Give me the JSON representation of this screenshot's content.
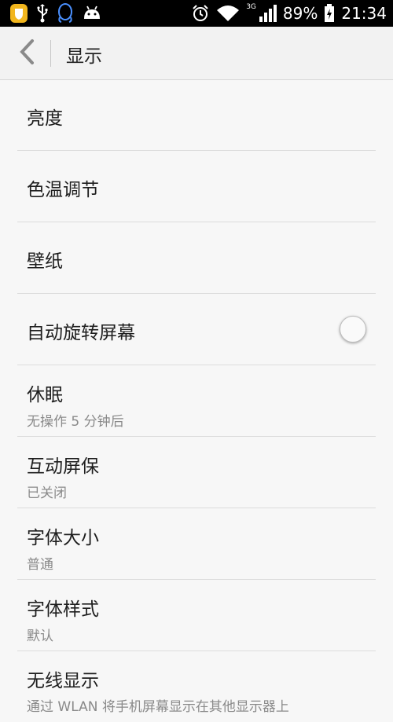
{
  "status_bar": {
    "network": "3G",
    "battery": "89%",
    "time": "21:34",
    "icons": [
      "shield-icon",
      "usb-icon",
      "qq-icon",
      "android-icon",
      "alarm-icon",
      "wifi-icon",
      "signal-icon",
      "battery-icon"
    ]
  },
  "header": {
    "title": "显示"
  },
  "settings": {
    "brightness": {
      "title": "亮度"
    },
    "color_temp": {
      "title": "色温调节"
    },
    "wallpaper": {
      "title": "壁纸"
    },
    "auto_rotate": {
      "title": "自动旋转屏幕",
      "enabled": false
    },
    "sleep": {
      "title": "休眠",
      "value": "无操作 5 分钟后"
    },
    "daydream": {
      "title": "互动屏保",
      "value": "已关闭"
    },
    "font_size": {
      "title": "字体大小",
      "value": "普通"
    },
    "font_style": {
      "title": "字体样式",
      "value": "默认"
    },
    "wireless_display": {
      "title": "无线显示",
      "value": "通过 WLAN 将手机屏幕显示在其他显示器上"
    }
  }
}
